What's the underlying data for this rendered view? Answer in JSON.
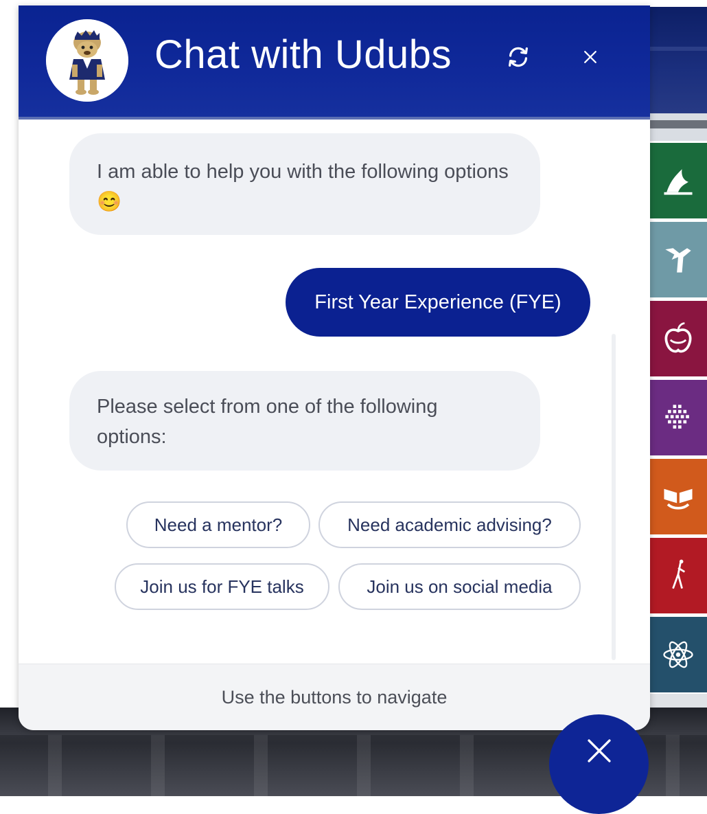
{
  "header": {
    "title": "Chat with Udubs",
    "refresh_icon": "refresh-icon",
    "close_icon": "close-icon",
    "avatar": "udubs-mascot-avatar"
  },
  "messages": {
    "bot_intro": "I am able to help you with the following options",
    "bot_intro_emoji": "😊",
    "user_choice": "First Year Experience (FYE)",
    "bot_prompt_line1": "Please select from one of the following",
    "bot_prompt_line2": "options:"
  },
  "options": [
    {
      "label": "Need a mentor?"
    },
    {
      "label": "Need academic advising?"
    },
    {
      "label": "Join us for FYE talks"
    },
    {
      "label": "Join us on social media"
    }
  ],
  "footer": {
    "hint": "Use the buttons to navigate"
  },
  "launcher": {
    "icon": "close-icon"
  },
  "side_tiles": [
    {
      "icon": "wing-icon",
      "color": "#1a6b3c"
    },
    {
      "icon": "hands-icon",
      "color": "#6f9aa6"
    },
    {
      "icon": "apple-icon",
      "color": "#8a1540"
    },
    {
      "icon": "grid-globe-icon",
      "color": "#6b2c82"
    },
    {
      "icon": "book-hands-icon",
      "color": "#d15a1c"
    },
    {
      "icon": "figure-icon",
      "color": "#b21a24"
    },
    {
      "icon": "atom-icon",
      "color": "#24506b"
    }
  ],
  "colors": {
    "brand_blue": "#0b2191",
    "bubble_grey": "#eff1f5"
  }
}
